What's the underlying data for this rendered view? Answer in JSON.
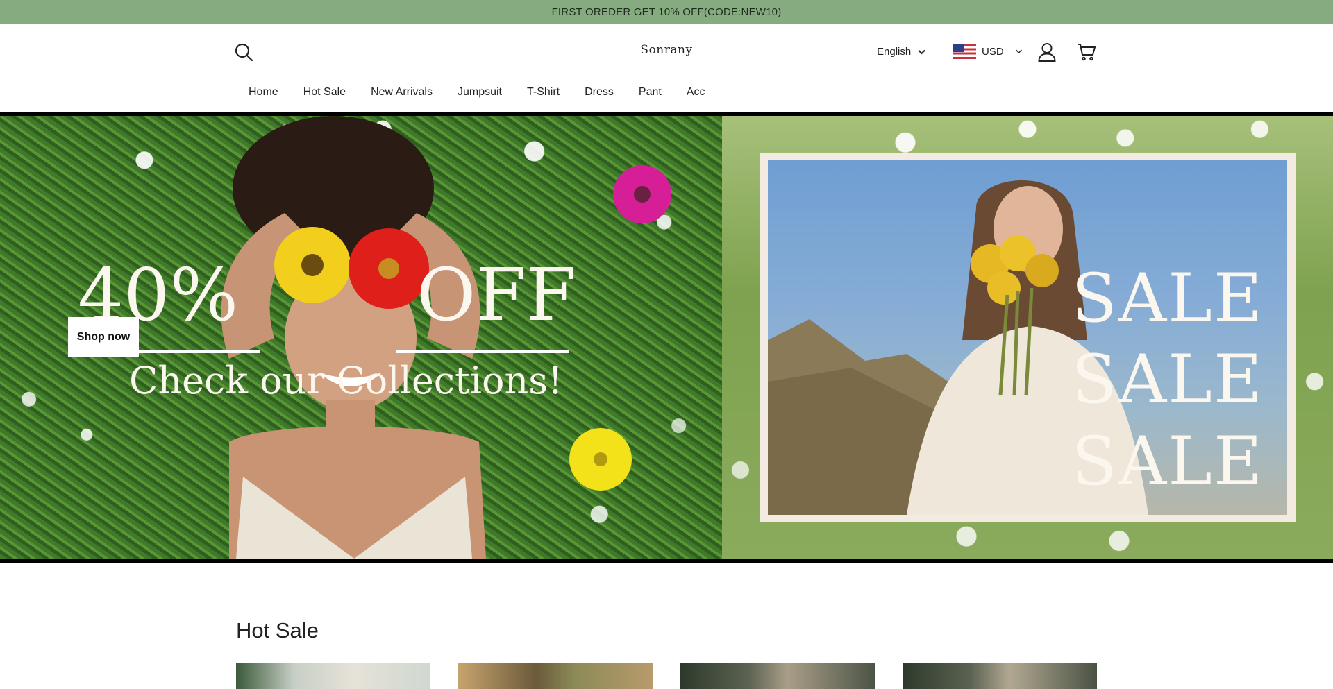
{
  "announcement": {
    "text": "FIRST OREDER GET 10% OFF(CODE:NEW10)",
    "background": "#86ab80"
  },
  "header": {
    "logo": "Sonrany",
    "language": "English",
    "currency": "USD",
    "icons": [
      "search-icon",
      "chevron-down-icon",
      "us-flag-icon",
      "account-icon",
      "cart-icon"
    ]
  },
  "nav": {
    "items": [
      {
        "label": "Home"
      },
      {
        "label": "Hot Sale"
      },
      {
        "label": "New Arrivals"
      },
      {
        "label": "Jumpsuit"
      },
      {
        "label": "T-Shirt"
      },
      {
        "label": "Dress"
      },
      {
        "label": "Pant"
      },
      {
        "label": "Acc"
      }
    ]
  },
  "hero": {
    "left": {
      "big_text_1": "40%",
      "big_text_2": "OFF",
      "subtitle": "Check our Collections!",
      "cta": "Shop now"
    },
    "right": {
      "sale_lines": [
        "SALE",
        "SALE",
        "SALE"
      ]
    }
  },
  "hot_sale": {
    "title": "Hot Sale",
    "cards": [
      {
        "bg": "#cfd8d0"
      },
      {
        "bg": "#b89a6c"
      },
      {
        "bg": "#4c5446"
      },
      {
        "bg": "#4a5244"
      }
    ]
  }
}
